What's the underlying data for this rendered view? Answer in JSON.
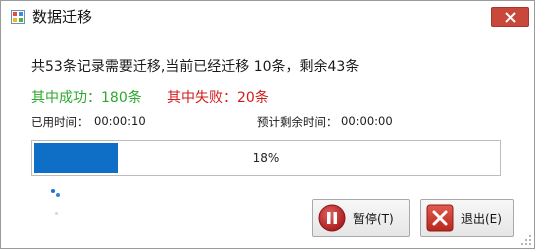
{
  "window": {
    "title": "数据迁移",
    "summary": "共53条记录需要迁移,当前已经迁移 10条，剩余43条",
    "success_text": "其中成功：180条",
    "fail_text": "其中失败：20条",
    "elapsed_label": "已用时间：",
    "elapsed_value": "00:00:10",
    "remaining_label": "预计剩余时间：",
    "remaining_value": "00:00:00",
    "progress": {
      "percent": 18,
      "label": "18%"
    },
    "buttons": {
      "pause": "暂停(T)",
      "exit": "退出(E)"
    }
  },
  "colors": {
    "success": "#2ea82e",
    "fail": "#d21c1c",
    "progress_fill": "#0f6fc6",
    "close_button": "#c9483c"
  },
  "icons": [
    "app-icon",
    "close-icon",
    "pause-icon",
    "exit-icon",
    "loading-spinner-icon",
    "resize-grip-icon"
  ]
}
